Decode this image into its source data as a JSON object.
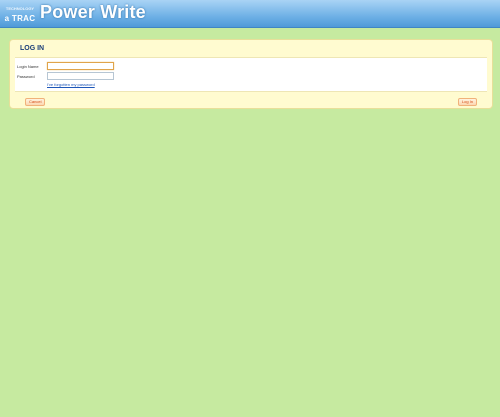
{
  "header": {
    "logo_top": "TECHNOLOGY",
    "logo_bottom": "a TRAC",
    "app_title": "Power Write"
  },
  "login_panel": {
    "title": "LOG IN",
    "login_name_label": "Login Name",
    "login_name_value": "",
    "password_label": "Password",
    "password_value": "",
    "forgot_link": "I've forgotten my password",
    "cancel_button": "Cancel",
    "login_button": "Log In"
  }
}
